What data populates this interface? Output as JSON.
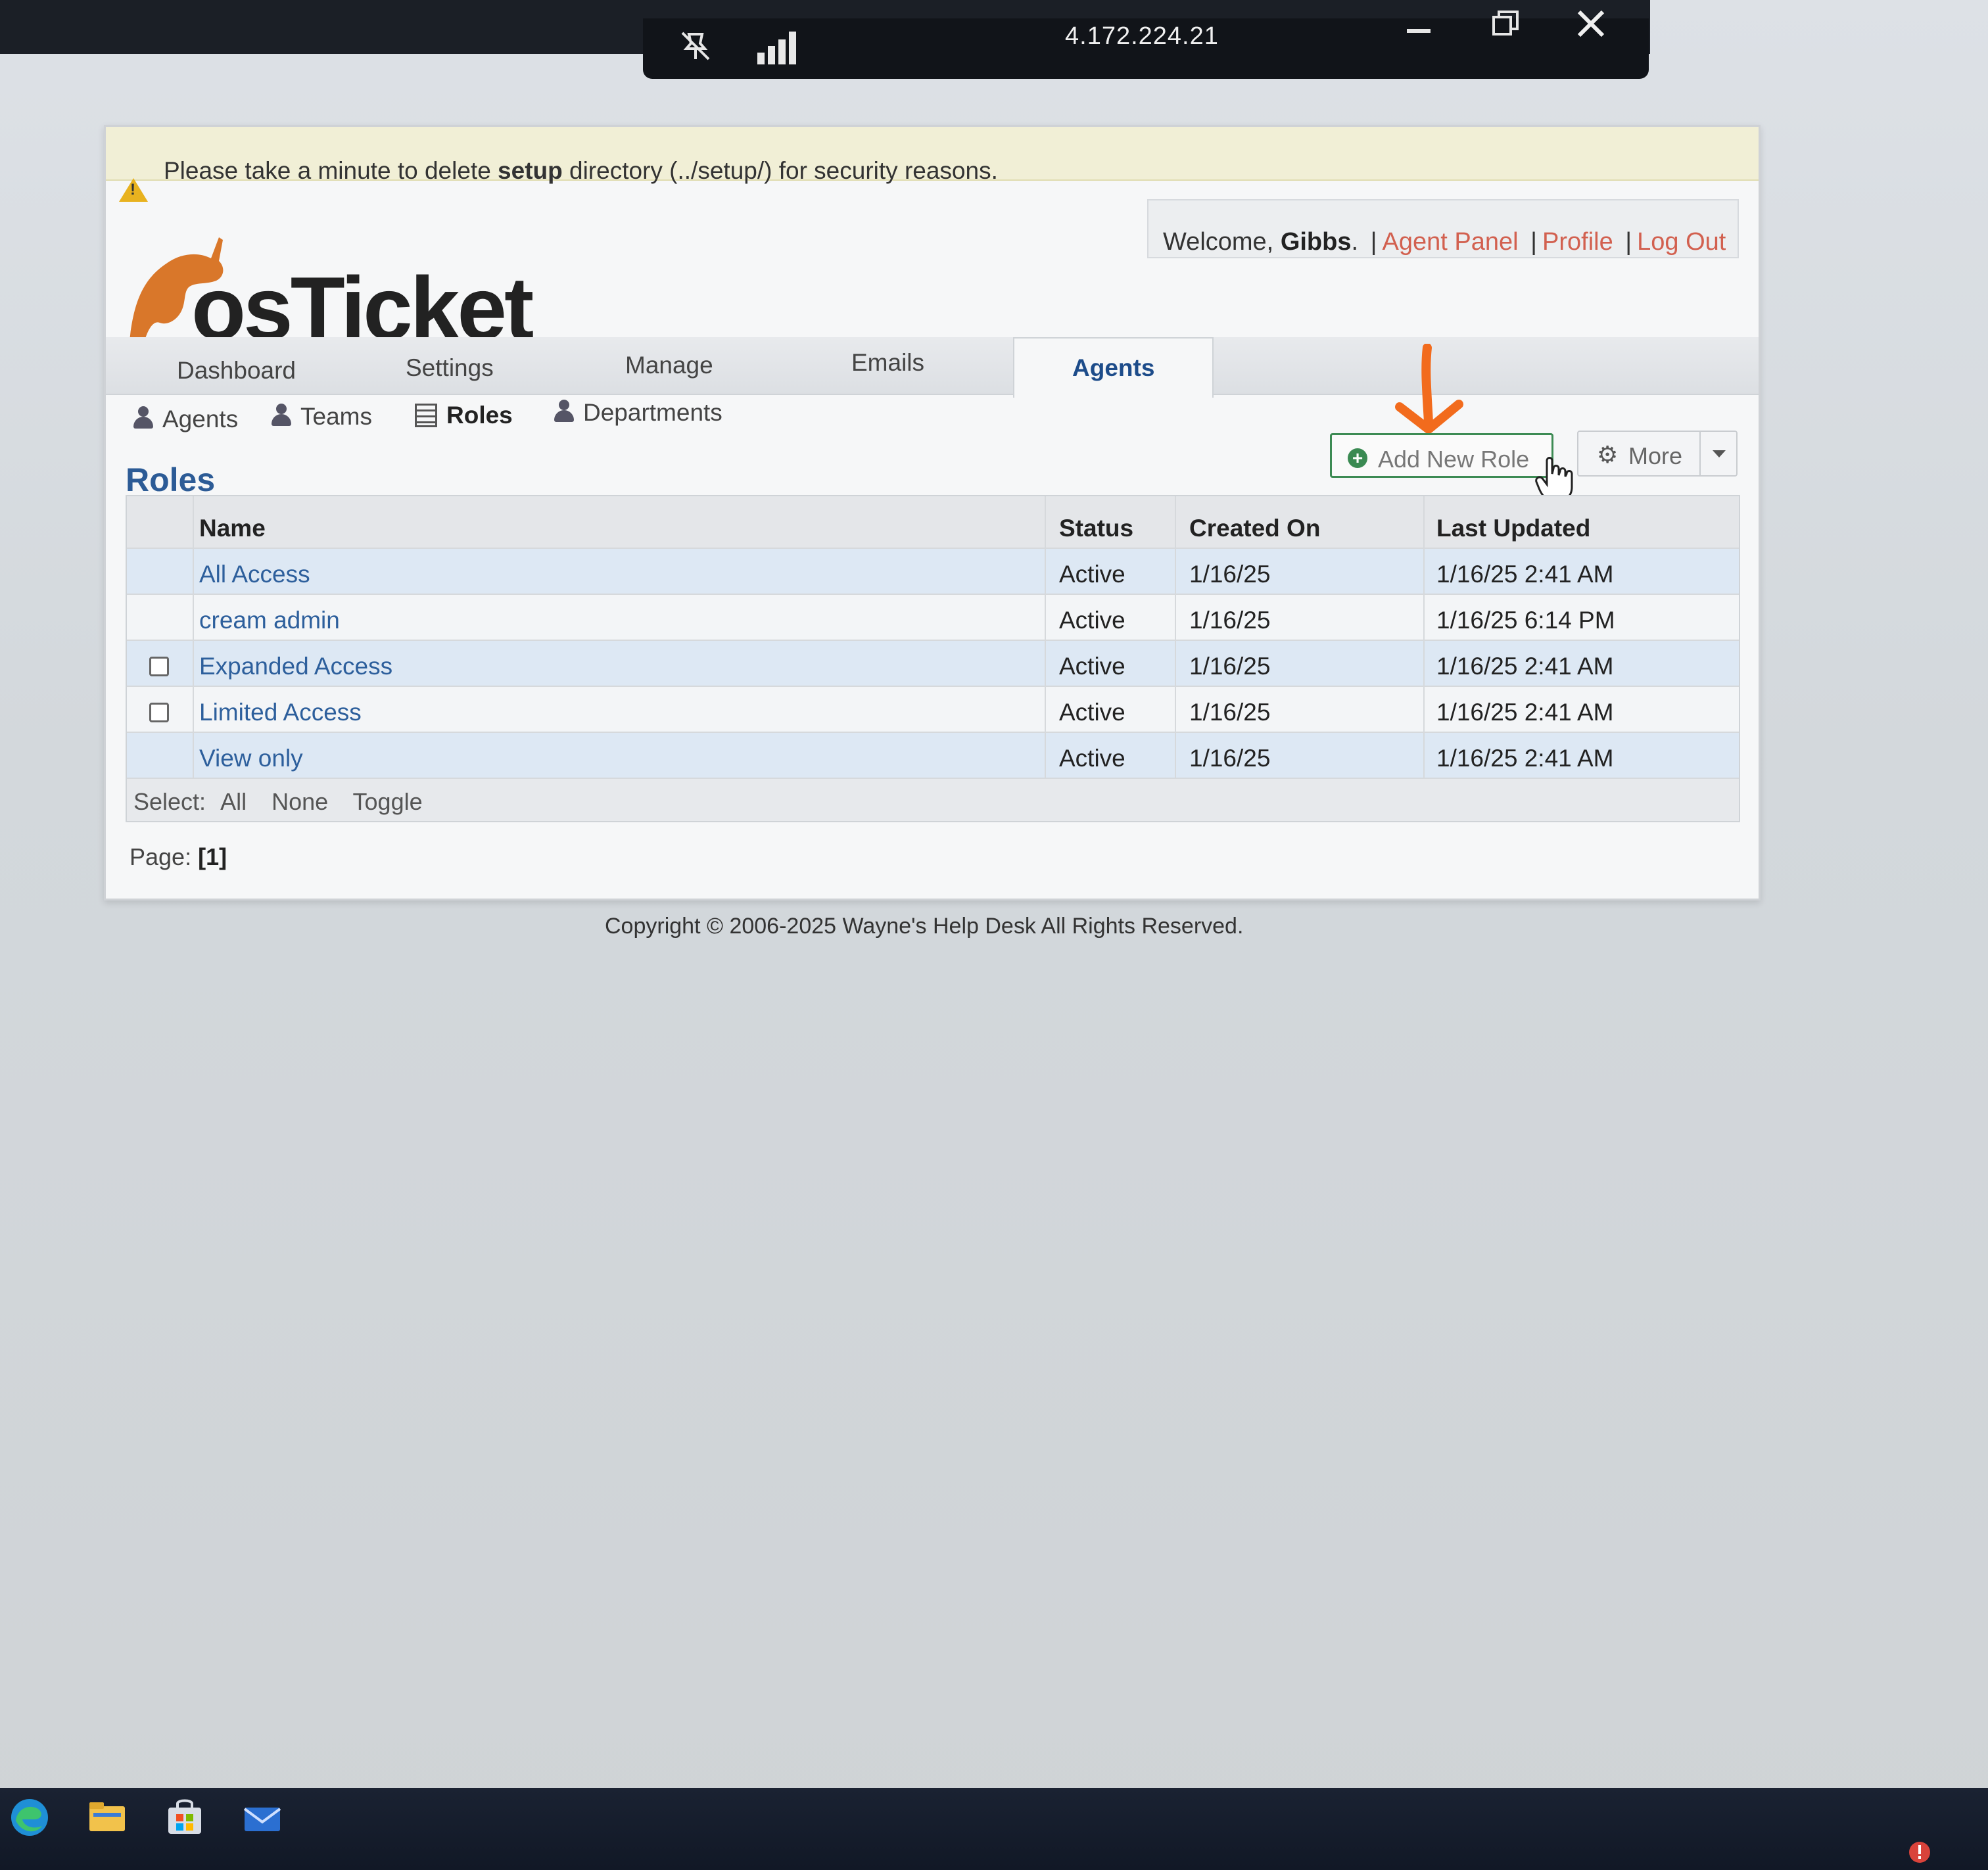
{
  "remote_session": {
    "ip": "4.172.224.21",
    "unpin_icon": "unpin-icon",
    "signal_icon": "signal-bars-icon",
    "minimize_icon": "minimize-icon",
    "restore_icon": "restore-icon",
    "close_icon": "close-icon"
  },
  "notice": {
    "prefix": "Please take a minute to delete ",
    "bold": "setup",
    "suffix": " directory (../setup/) for security reasons."
  },
  "brand": {
    "logo_text": "osTicket"
  },
  "user": {
    "welcome": "Welcome,",
    "name": "Gibbs",
    "name_suffix": ".",
    "agent_panel": "Agent Panel",
    "profile": "Profile",
    "logout": "Log Out",
    "separator": "|"
  },
  "tabs": [
    "Dashboard",
    "Settings",
    "Manage",
    "Emails",
    "Agents"
  ],
  "active_tab": "Agents",
  "subnav": {
    "agents": "Agents",
    "teams": "Teams",
    "roles": "Roles",
    "departments": "Departments"
  },
  "page_title": "Roles",
  "buttons": {
    "add_new_role": "Add New Role",
    "more": "More"
  },
  "table": {
    "headers": {
      "name": "Name",
      "status": "Status",
      "created": "Created On",
      "updated": "Last Updated"
    },
    "rows": [
      {
        "name": "All Access",
        "status": "Active",
        "created": "1/16/25",
        "updated": "1/16/25 2:41 AM",
        "checkbox": false
      },
      {
        "name": "cream admin",
        "status": "Active",
        "created": "1/16/25",
        "updated": "1/16/25 6:14 PM",
        "checkbox": false
      },
      {
        "name": "Expanded Access",
        "status": "Active",
        "created": "1/16/25",
        "updated": "1/16/25 2:41 AM",
        "checkbox": true
      },
      {
        "name": "Limited Access",
        "status": "Active",
        "created": "1/16/25",
        "updated": "1/16/25 2:41 AM",
        "checkbox": true
      },
      {
        "name": "View only",
        "status": "Active",
        "created": "1/16/25",
        "updated": "1/16/25 2:41 AM",
        "checkbox": false
      }
    ],
    "select_label": "Select:",
    "select_all": "All",
    "select_none": "None",
    "select_toggle": "Toggle"
  },
  "pager": {
    "label": "Page:",
    "current": "[1]"
  },
  "footer": {
    "copyright": "Copyright © 2006-2025 Wayne's Help Desk All Rights Reserved."
  },
  "colors": {
    "accent_link": "#d2604f",
    "title_blue": "#2c5b96",
    "add_button_border": "#3d8b54",
    "annotation_arrow": "#f26b1d"
  }
}
